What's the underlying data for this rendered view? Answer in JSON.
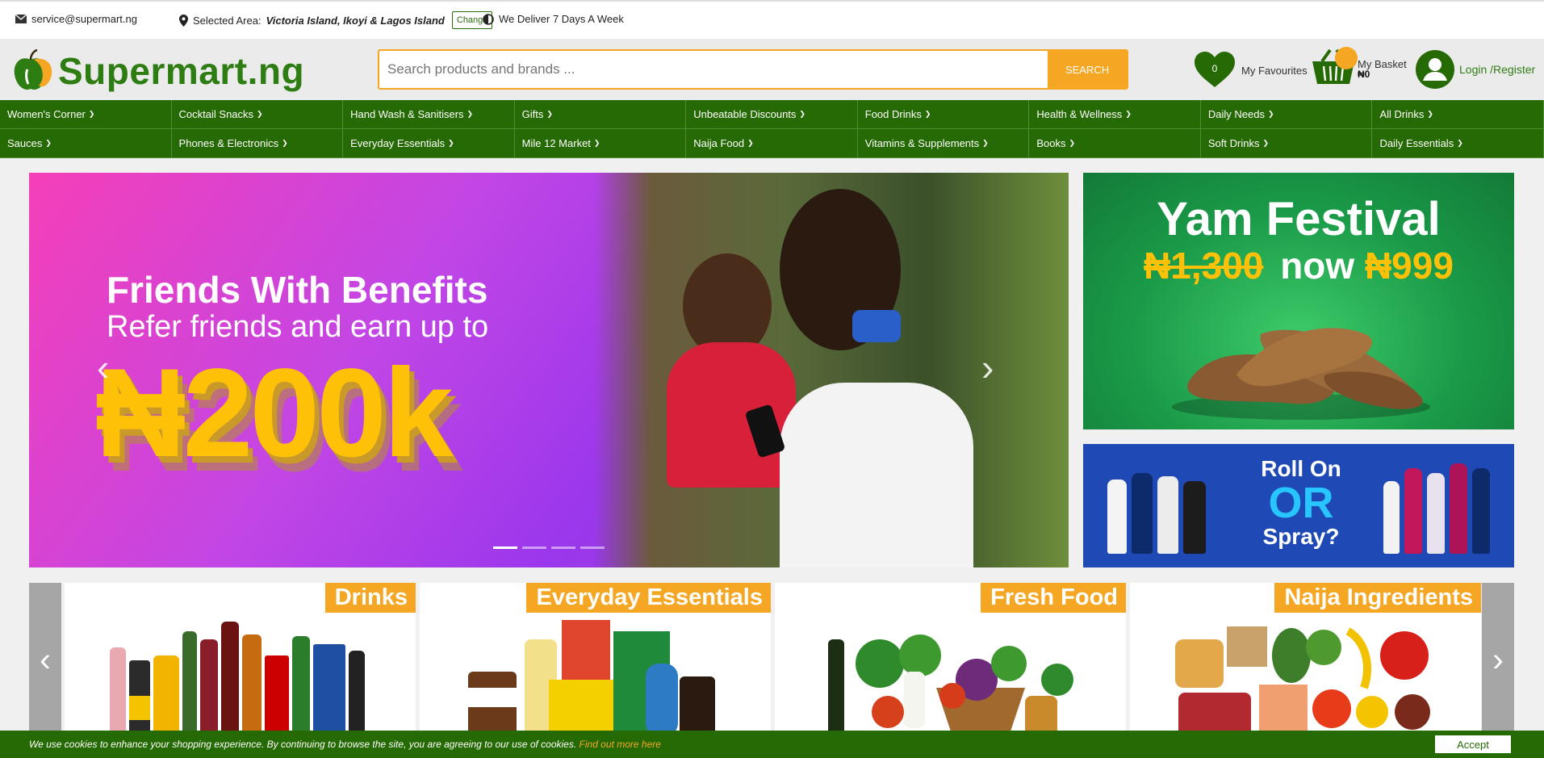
{
  "topbar": {
    "email": "service@supermart.ng",
    "area_label": "Selected Area:",
    "area_value": "Victoria Island, Ikoyi & Lagos Island",
    "change_label": "Change",
    "delivery_text": "We Deliver 7 Days A Week"
  },
  "header": {
    "logo_text": "Supermart.ng",
    "search_placeholder": "Search products and brands ...",
    "search_button": "SEARCH",
    "favourites_count": "0",
    "favourites_label": "My Favourites",
    "basket_label": "My Basket",
    "basket_amount": "₦0",
    "login_label": "Login /Register"
  },
  "categories": [
    "Women's Corner",
    "Cocktail Snacks",
    "Hand Wash & Sanitisers",
    "Gifts",
    "Unbeatable Discounts",
    "Food Drinks",
    "Health & Wellness",
    "Daily Needs",
    "All Drinks",
    "Sauces",
    "Phones & Electronics",
    "Everyday Essentials",
    "Mile 12 Market",
    "Naija Food",
    "Vitamins & Supplements",
    "Books",
    "Soft Drinks",
    "Daily Essentials"
  ],
  "hero": {
    "title": "Friends With Benefits",
    "subtitle": "Refer friends and earn up to",
    "amount": "₦200k",
    "slide_count": 4,
    "active_slide": 1
  },
  "side_banners": {
    "yam_title": "Yam Festival",
    "yam_old_price": "₦1,300",
    "yam_now": "now",
    "yam_new_price": "₦999",
    "rollon_line1": "Roll On",
    "rollon_line2": "OR",
    "rollon_line3": "Spray?"
  },
  "category_cards": [
    {
      "label": "Drinks"
    },
    {
      "label": "Everyday Essentials"
    },
    {
      "label": "Fresh Food"
    },
    {
      "label": "Naija Ingredients"
    }
  ],
  "cookie": {
    "text": "We use cookies to enhance your shopping experience. By continuing to browse the site, you are agreeing to our use of cookies.",
    "link": "Find out more here",
    "accept": "Accept"
  },
  "colors": {
    "brand_green": "#266a05",
    "accent_orange": "#f5a623"
  }
}
